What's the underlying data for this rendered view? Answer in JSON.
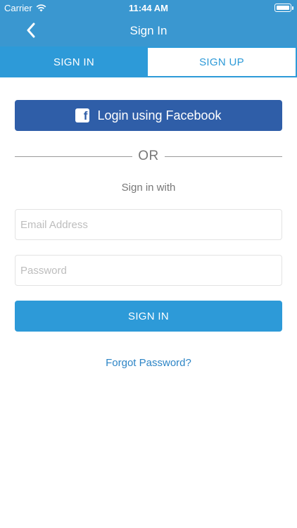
{
  "status_bar": {
    "carrier": "Carrier",
    "time": "11:44 AM"
  },
  "nav": {
    "title": "Sign In"
  },
  "tabs": [
    {
      "label": "SIGN IN",
      "active": true
    },
    {
      "label": "SIGN UP",
      "active": false
    }
  ],
  "facebook": {
    "label": "Login using Facebook",
    "icon": "f"
  },
  "divider": {
    "text": "OR"
  },
  "signin_with": "Sign in with",
  "email": {
    "placeholder": "Email Address",
    "value": ""
  },
  "password": {
    "placeholder": "Password",
    "value": ""
  },
  "signin_button": "SIGN IN",
  "forgot_password": "Forgot Password?",
  "colors": {
    "header": "#3a97d0",
    "accent": "#2d9ad8",
    "facebook": "#2f5ea8",
    "link": "#2d85c6"
  }
}
